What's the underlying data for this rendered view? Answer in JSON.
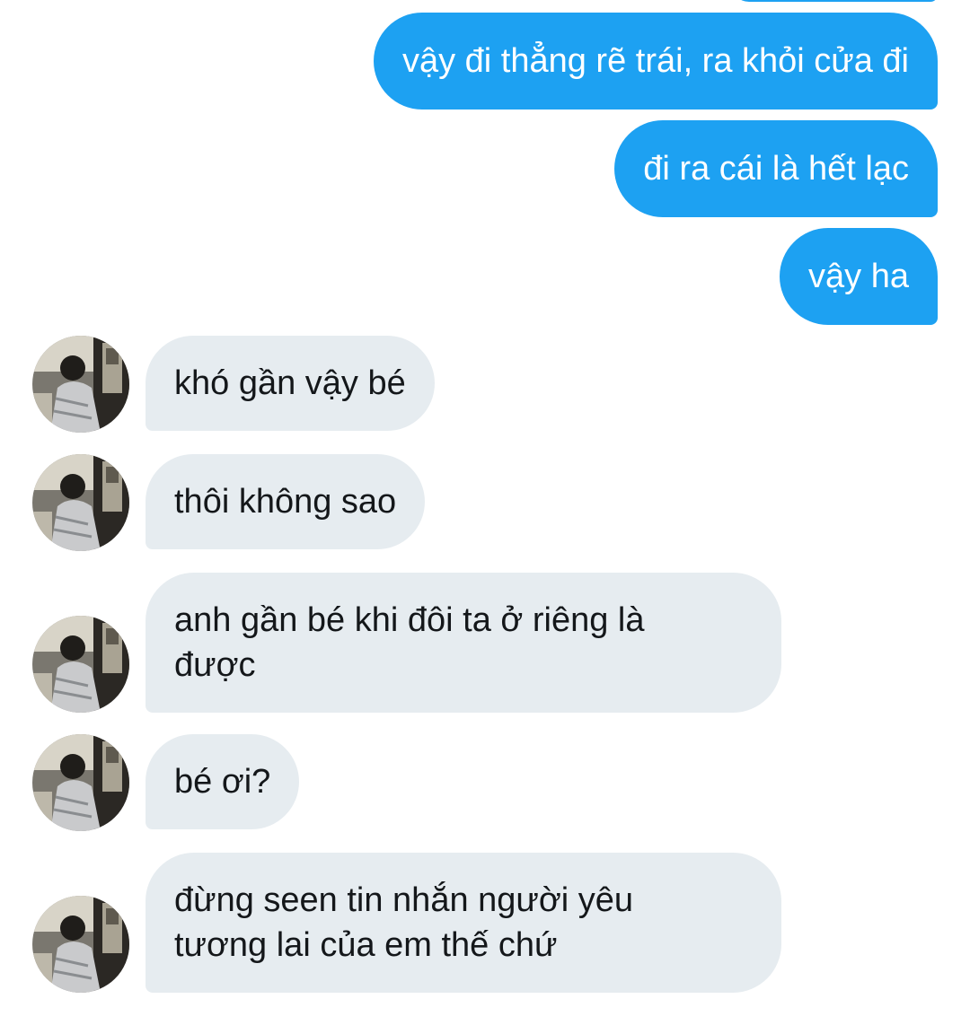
{
  "conversation": {
    "outgoing": [
      {
        "text": "vậy đi thẳng rẽ trái, ra khỏi cửa đi"
      },
      {
        "text": "đi ra cái là hết lạc"
      },
      {
        "text": "vậy ha"
      }
    ],
    "incoming": [
      {
        "text": "khó gần vậy bé"
      },
      {
        "text": "thôi không sao"
      },
      {
        "text": "anh gần bé khi đôi ta ở riêng là\nđược"
      },
      {
        "text": "bé ơi?"
      },
      {
        "text": "đừng seen tin nhắn người yêu\ntương lai của em thế chứ"
      }
    ]
  },
  "colors": {
    "outgoing_bubble": "#1da1f2",
    "incoming_bubble": "#e6ecf0"
  }
}
